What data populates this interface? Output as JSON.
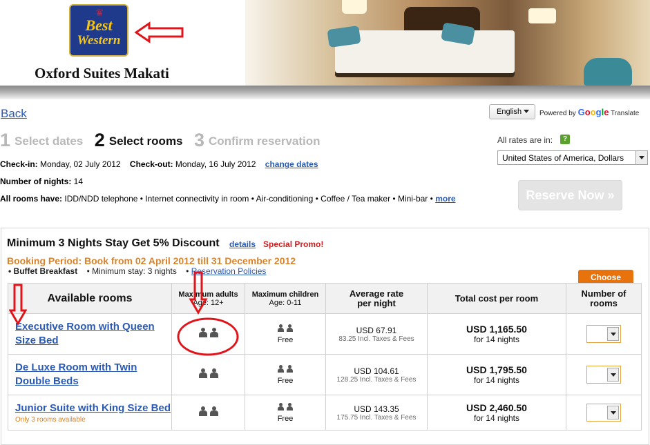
{
  "header": {
    "logo_line1": "Best",
    "logo_line2": "Western",
    "hotel_name": "Oxford Suites Makati"
  },
  "nav": {
    "back": "Back",
    "language": "English",
    "powered_by": "Powered by",
    "google": [
      "G",
      "o",
      "o",
      "g",
      "l",
      "e"
    ],
    "translate": "Translate"
  },
  "steps": [
    {
      "num": "1",
      "label": "Select dates"
    },
    {
      "num": "2",
      "label": "Select rooms"
    },
    {
      "num": "3",
      "label": "Confirm reservation"
    }
  ],
  "rates": {
    "label": "All rates are in:",
    "help": "?",
    "currency": "United States of America, Dollars"
  },
  "booking": {
    "checkin_label": "Check-in:",
    "checkin_value": "Monday, 02 July 2012",
    "checkout_label": "Check-out:",
    "checkout_value": "Monday, 16 July 2012",
    "change_dates": "change dates",
    "nights_label": "Number of nights:",
    "nights_value": "14",
    "amenities_label": "All rooms have:",
    "amenities": "IDD/NDD telephone • Internet connectivity in room • Air-conditioning • Coffee / Tea maker • Mini-bar •",
    "more": "more",
    "reserve": "Reserve Now »"
  },
  "promo": {
    "title": "Minimum 3 Nights Stay Get 5% Discount",
    "details": "details",
    "special": "Special Promo!",
    "period": "Booking Period: Book from 02 April 2012 till 31 December 2012",
    "feature1": "• Buffet Breakfast",
    "feature2": "• Minimum stay: 3 nights",
    "feature3_prefix": "•",
    "policies": "Reservation Policies",
    "choose": "Choose"
  },
  "table": {
    "headers": {
      "rooms": "Available rooms",
      "adults": "Maximum adults",
      "adults_sub": "Age: 12+",
      "children": "Maximum children",
      "children_sub": "Age: 0-11",
      "rate": "Average rate per night",
      "total": "Total cost per room",
      "number": "Number of rooms"
    },
    "rows": [
      {
        "name": "Executive Room with Queen Size Bed",
        "availability": "",
        "free": "Free",
        "rate": "USD 67.91",
        "rate_incl": "83.25 Incl. Taxes & Fees",
        "total": "USD 1,165.50",
        "nights": "for 14 nights"
      },
      {
        "name": "De Luxe Room with Twin Double Beds",
        "availability": "",
        "free": "Free",
        "rate": "USD 104.61",
        "rate_incl": "128.25 Incl. Taxes & Fees",
        "total": "USD 1,795.50",
        "nights": "for 14 nights"
      },
      {
        "name": "Junior Suite with King Size Bed",
        "availability": "Only 3 rooms available",
        "free": "Free",
        "rate": "USD 143.35",
        "rate_incl": "175.75 Incl. Taxes & Fees",
        "total": "USD 2,460.50",
        "nights": "for 14 nights"
      }
    ]
  },
  "colors": {
    "link": "#2a5ab4",
    "accent_orange": "#e8720c",
    "promo_red": "#cc1f1f",
    "annotation_red": "#e0151b"
  }
}
